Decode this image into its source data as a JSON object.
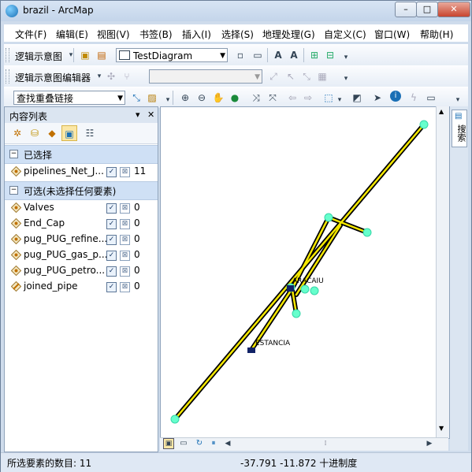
{
  "window": {
    "title": "brazil - ArcMap",
    "min": "–",
    "max": "□",
    "close": "✕"
  },
  "menu": [
    "文件(F)",
    "编辑(E)",
    "视图(V)",
    "书签(B)",
    "插入(I)",
    "选择(S)",
    "地理处理(G)",
    "自定义(C)",
    "窗口(W)",
    "帮助(H)"
  ],
  "toolbar1": {
    "label": "逻辑示意图",
    "diagram": "TestDiagram"
  },
  "toolbar2": {
    "label": "逻辑示意图编辑器"
  },
  "toolbar3": {
    "combo": "查找重叠链接"
  },
  "toc": {
    "title": "内容列表",
    "pin": "▾",
    "close": "✕",
    "group_selected": "已选择",
    "group_selectable": "可选(未选择任何要素)",
    "expand": "−",
    "selected_layers": [
      {
        "name": "pipelines_Net_J...",
        "count": "11"
      }
    ],
    "layers": [
      {
        "name": "Valves",
        "count": "0"
      },
      {
        "name": "End_Cap",
        "count": "0"
      },
      {
        "name": "pug_PUG_refine...",
        "count": "0"
      },
      {
        "name": "pug_PUG_gas_p...",
        "count": "0"
      },
      {
        "name": "pug_PUG_petro...",
        "count": "0"
      },
      {
        "name": "joined_pipe",
        "count": "0"
      }
    ]
  },
  "map": {
    "labels": {
      "aracaju": "ARACAIU",
      "estancia": "ESTANCIA"
    },
    "colors": {
      "pipe": "#f5e800",
      "node": "#66ffcc",
      "outline": "#000000"
    }
  },
  "side_tab": "搜索",
  "status": {
    "selected_count": "所选要素的数目: 11",
    "coords": "-37.791  -11.872 十进制度"
  }
}
